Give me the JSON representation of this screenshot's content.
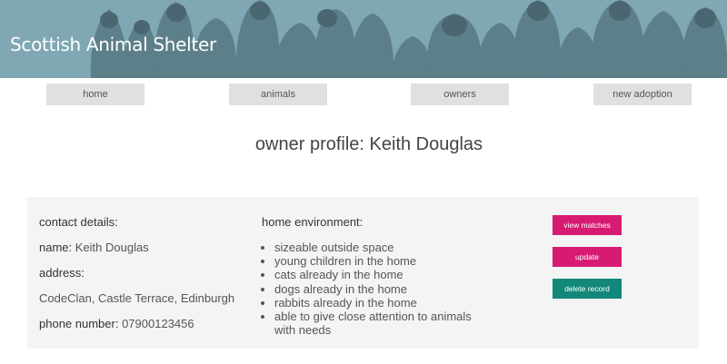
{
  "site": {
    "title": "Scottish Animal Shelter"
  },
  "nav": [
    {
      "label": "home"
    },
    {
      "label": "animals"
    },
    {
      "label": "owners"
    },
    {
      "label": "new adoption"
    }
  ],
  "page": {
    "title": "owner profile: Keith Douglas"
  },
  "contact": {
    "heading": "contact details:",
    "name_label": "name:",
    "name_value": "Keith Douglas",
    "address_label": "address:",
    "address_value": "CodeClan, Castle Terrace, Edinburgh",
    "phone_label": "phone number:",
    "phone_value": "07900123456"
  },
  "home_environment": {
    "heading": "home environment:",
    "items": [
      "sizeable outside space",
      "young children in the home",
      "cats already in the home",
      "dogs already in the home",
      "rabbits already in the home",
      "able to give close attention to animals with needs"
    ]
  },
  "actions": {
    "view_matches": "view matches",
    "update": "update",
    "delete": "delete record"
  },
  "colors": {
    "banner": "#7fa7b4",
    "magenta": "#d81b72",
    "teal": "#12887a"
  }
}
